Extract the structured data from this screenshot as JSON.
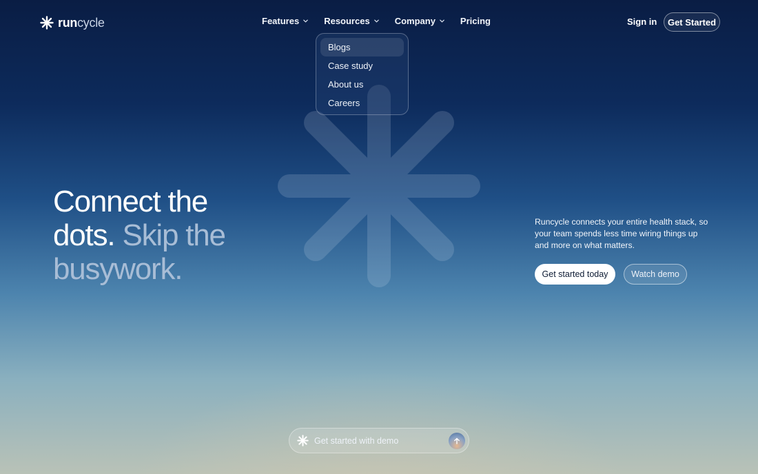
{
  "header": {
    "brand_part1": "run",
    "brand_part2": "cycle",
    "nav": [
      {
        "label": "Features",
        "has_dropdown": true
      },
      {
        "label": "Resources",
        "has_dropdown": true
      },
      {
        "label": "Company",
        "has_dropdown": true
      },
      {
        "label": "Pricing",
        "has_dropdown": false
      }
    ],
    "signin_label": "Sign in",
    "get_started_label": "Get Started"
  },
  "dropdown": {
    "items": [
      "Blogs",
      "Case study",
      "About us",
      "Careers"
    ],
    "active_index": 0
  },
  "hero": {
    "line1": "Connect the",
    "line2_white": "dots.",
    "line2_muted": "Skip the",
    "line3": "busywork.",
    "description": "Runcycle connects your entire health stack, so your team spends less time wiring things up and more on what matters.",
    "primary_cta": "Get started today",
    "secondary_cta": "Watch demo"
  },
  "demo_bar": {
    "text": "Get started with demo"
  },
  "icons": {
    "logo": "asterisk-logo-icon",
    "chevron": "chevron-down-icon",
    "send": "arrow-up-icon"
  },
  "colors": {
    "bg_top": "#0a1d44",
    "bg_bottom": "#b9c2b7",
    "muted_text": "#a8bdd6",
    "primary_button_bg": "#ffffff"
  }
}
